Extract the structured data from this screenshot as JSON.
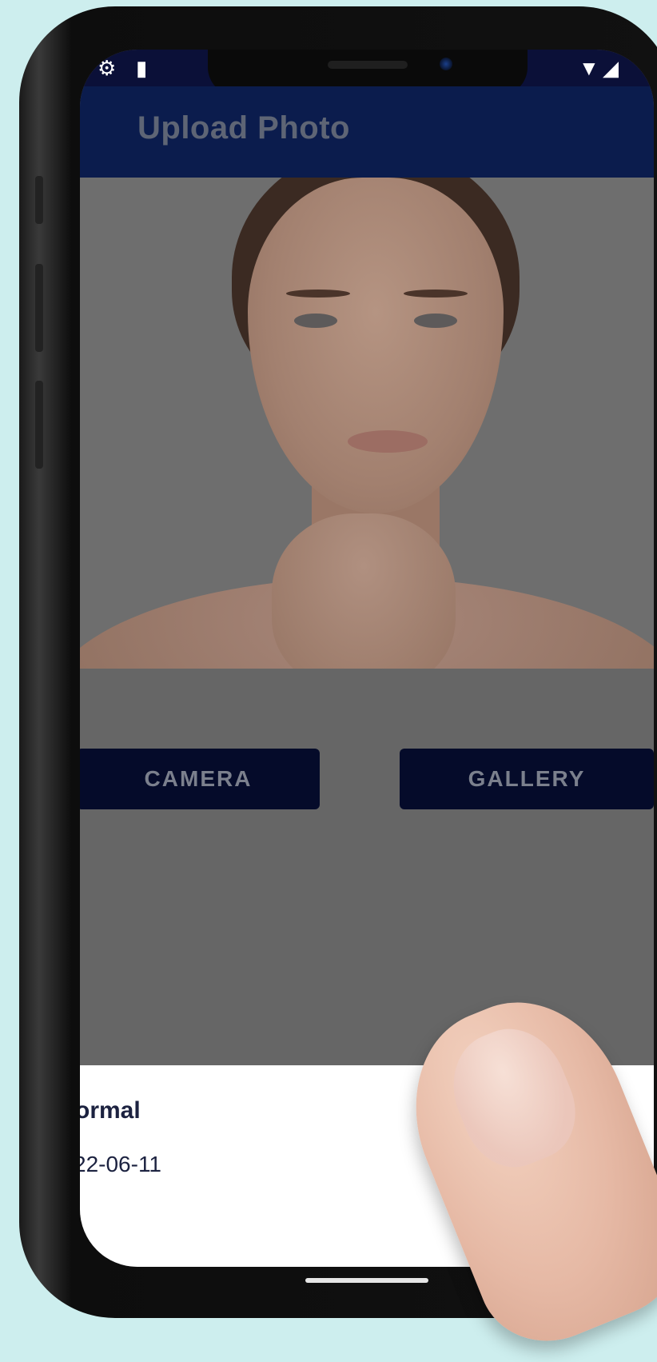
{
  "status_bar": {
    "left_icons": [
      "gear-icon",
      "sd-card-icon"
    ],
    "right_icons": [
      "wifi-icon",
      "signal-icon"
    ]
  },
  "app_bar": {
    "title": "Upload Photo"
  },
  "photo": {
    "icon": "portrait-photo"
  },
  "actions": {
    "camera_label": "CAMERA",
    "gallery_label": "GALLERY"
  },
  "bottom_sheet": {
    "title_partial": "ormal",
    "date_partial": "22-06-11"
  },
  "colors": {
    "app_bar_bg": "#0b1c4d",
    "button_bg": "#050b2a",
    "scrim": "#666666",
    "sheet_bg": "#ffffff"
  }
}
